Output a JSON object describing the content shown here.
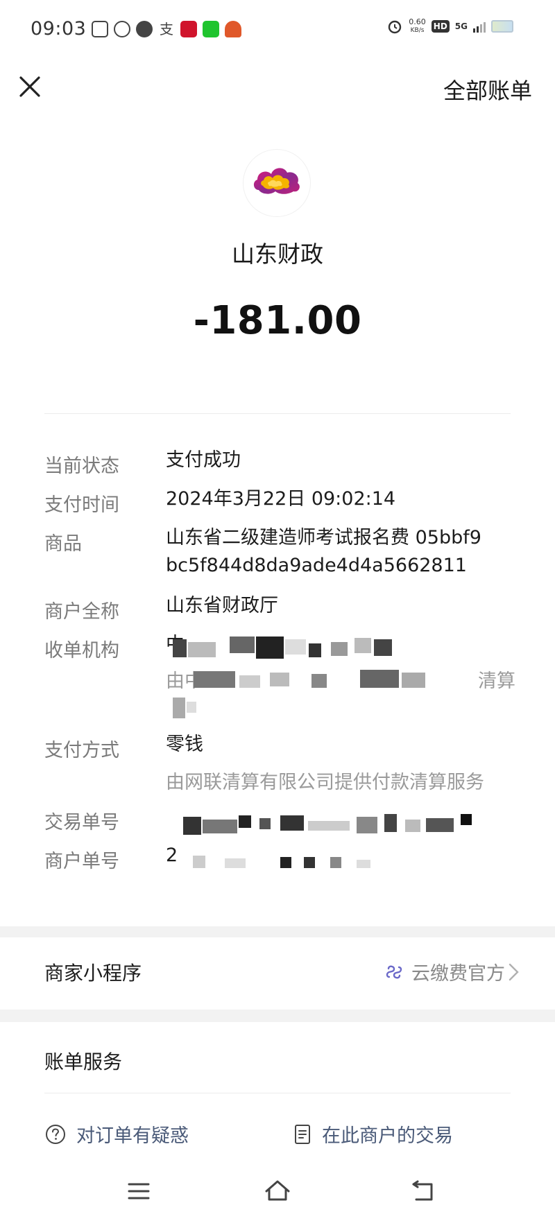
{
  "status_bar": {
    "time": "09:03",
    "net_speed_value": "0.60",
    "net_speed_unit": "KB/s",
    "hd": "HD",
    "network": "5G",
    "icons": [
      "alarm-icon",
      "hd-icon",
      "signal-icon",
      "battery-icon"
    ]
  },
  "header": {
    "close_icon": "close-icon",
    "all_bills": "全部账单"
  },
  "merchant": {
    "logo_icon": "cloud-logo-icon",
    "name": "山东财政",
    "amount": "-181.00"
  },
  "details": {
    "status": {
      "label": "当前状态",
      "value": "支付成功"
    },
    "pay_time": {
      "label": "支付时间",
      "value": "2024年3月22日 09:02:14"
    },
    "goods": {
      "label": "商品",
      "value": "山东省二级建造师考试报名费 05bbf9bc5f844d8da9ade4d4a5662811"
    },
    "merchant_full_name": {
      "label": "商户全称",
      "value": "山东省财政厅"
    },
    "acquirer": {
      "label": "收单机构",
      "partial_1": "中",
      "partial_2": "由中",
      "partial_3": "清算"
    },
    "pay_method": {
      "label": "支付方式",
      "value": "零钱",
      "sub": "由网联清算有限公司提供付款清算服务"
    },
    "transaction_no": {
      "label": "交易单号"
    },
    "merchant_order_no": {
      "label": "商户单号",
      "partial": "2"
    }
  },
  "mini_program": {
    "title": "商家小程序",
    "value": "云缴费官方",
    "icon": "mini-program-link-icon"
  },
  "bill_service": {
    "title": "账单服务",
    "question_label": "对订单有疑惑",
    "question_icon": "question-icon",
    "merchant_tx_label": "在此商户的交易",
    "merchant_tx_icon": "document-icon"
  },
  "colors": {
    "label_gray": "#7a7a7a",
    "band_gray": "#f2f2f2",
    "link_blue": "#4a5a78",
    "logo_magenta": "#c0207a",
    "logo_yellow": "#f5b400"
  }
}
